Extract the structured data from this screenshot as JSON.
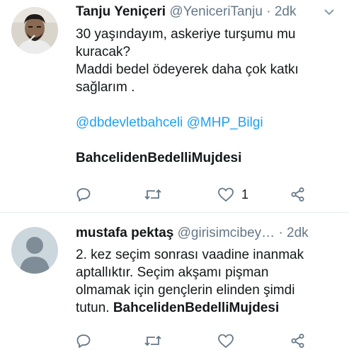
{
  "tweets": [
    {
      "name": "Tanju Yeniçeri",
      "handle": "@YeniceriTanju",
      "dot": "·",
      "time": "2dk",
      "lines": [
        "30 yaşındayım, askeriye turşumu mu",
        "kuracak?",
        "Maddi bedel ödeyerek daha çok katkı",
        "sağlarım ."
      ],
      "mentions": [
        "@dbdevletbahceli",
        "@MHP_Bilgi"
      ],
      "hashtag": "BahcelidenBedelliMujdesi",
      "likes": "1"
    },
    {
      "name": "mustafa pektaş",
      "handle": "@girisimcibey…",
      "dot": "·",
      "time": "2dk",
      "lines": [
        "2. kez seçim sonrası vaadine inanmak",
        "aptallıktır. Seçim akşamı pişman",
        "olmamak için gençlerin elinden şimdi"
      ],
      "last_line_prefix": "tutun.",
      "hashtag": "BahcelidenBedelliMujdesi"
    }
  ],
  "icons": [
    "reply-icon",
    "retweet-icon",
    "like-icon",
    "share-icon",
    "caret-down-icon",
    "default-avatar-icon"
  ],
  "colors": {
    "accent": "#1da1f2",
    "muted": "#657786",
    "text": "#14171a",
    "divider": "#e6ecf0"
  }
}
